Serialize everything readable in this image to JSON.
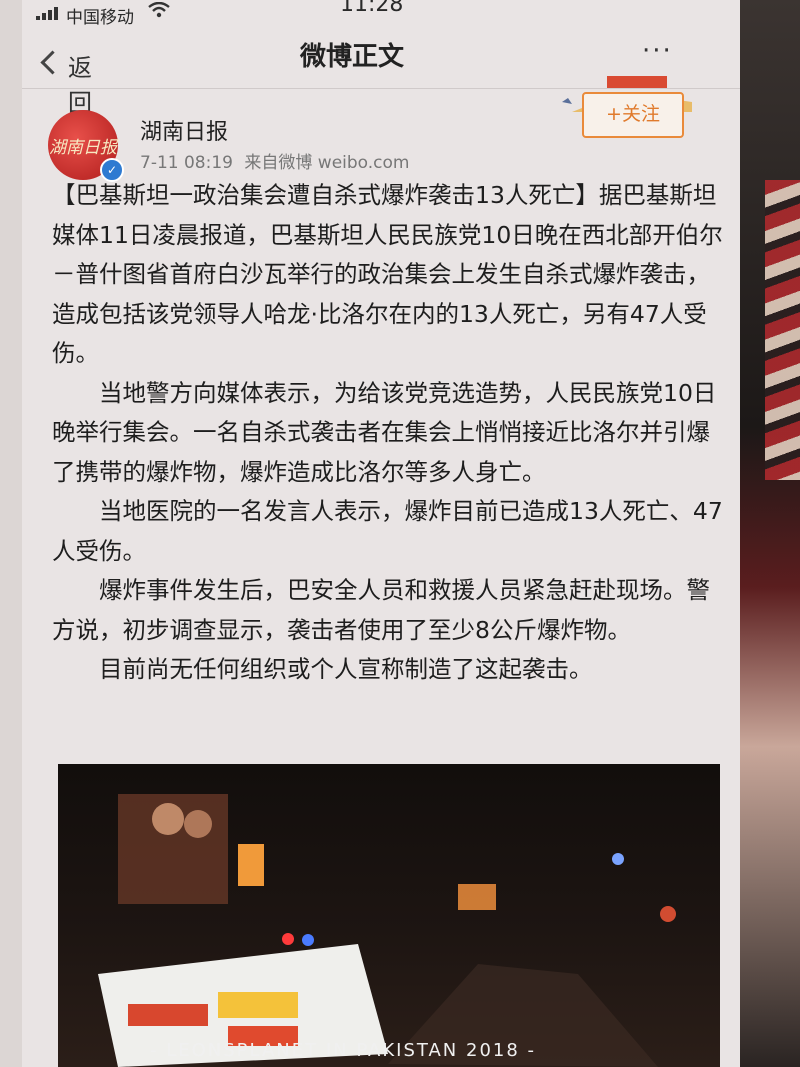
{
  "status_bar": {
    "carrier": "中国移动",
    "time": "11:28"
  },
  "nav": {
    "back_label": "返回",
    "title": "微博正文",
    "more_label": "···"
  },
  "post": {
    "author": "湖南日报",
    "avatar_text": "湖南日报",
    "timestamp": "7-11 08:19",
    "source": "来自微博 weibo.com",
    "follow_label": "+关注",
    "paragraphs": [
      "【巴基斯坦一政治集会遭自杀式爆炸袭击13人死亡】据巴基斯坦媒体11日凌晨报道，巴基斯坦人民民族党10日晚在西北部开伯尔－普什图省首府白沙瓦举行的政治集会上发生自杀式爆炸袭击，造成包括该党领导人哈龙·比洛尔在内的13人死亡，另有47人受伤。",
      "当地警方向媒体表示，为给该党竞选造势，人民民族党10日晚举行集会。一名自杀式袭击者在集会上悄悄接近比洛尔并引爆了携带的爆炸物，爆炸造成比洛尔等多人身亡。",
      "当地医院的一名发言人表示，爆炸目前已造成13人死亡、47人受伤。",
      "爆炸事件发生后，巴安全人员和救援人员紧急赶赴现场。警方说，初步调查显示，袭击者使用了至少8公斤爆炸物。",
      "目前尚无任何组织或个人宣称制造了这起袭击。"
    ]
  },
  "watermark": "- LEONSPLANET IN PAKISTAN 2018 -",
  "colors": {
    "follow_accent": "#e07a2c",
    "verified_badge": "#2e7ad1",
    "avatar_red": "#c0262a"
  }
}
